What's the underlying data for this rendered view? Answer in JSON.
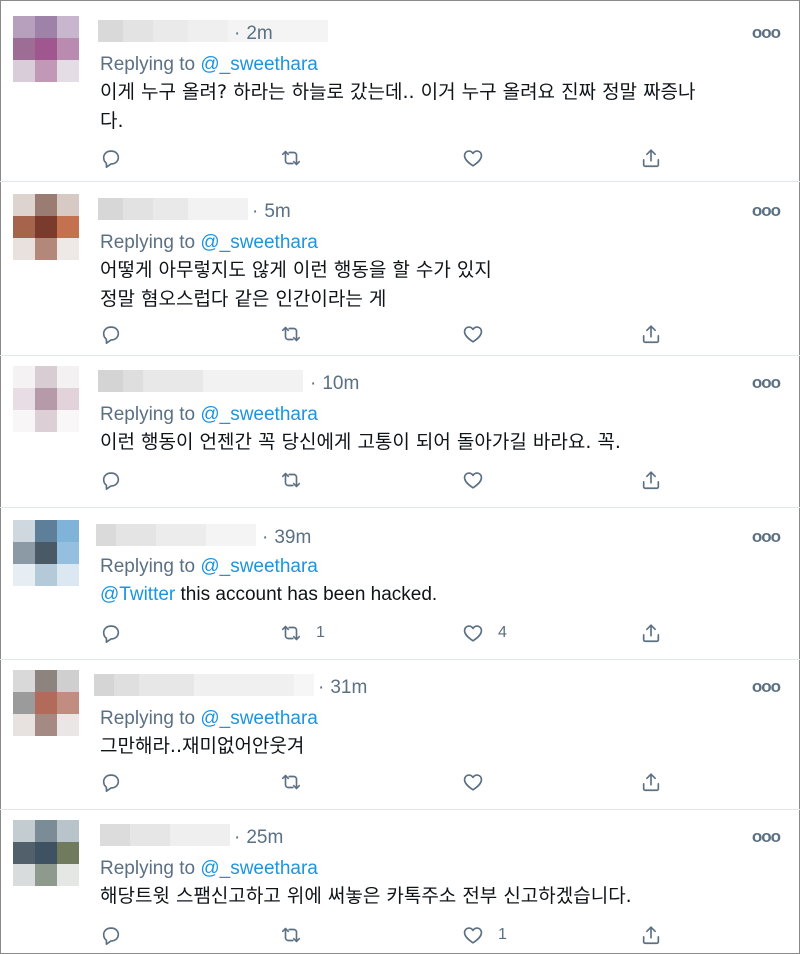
{
  "replying_label": "Replying to",
  "colors": {
    "muted": "#5b7083",
    "link": "#1b95e0",
    "text": "#0f1419",
    "divider": "#e1e6ea"
  },
  "icons": {
    "reply": "reply-icon",
    "retweet": "retweet-icon",
    "like": "like-icon",
    "share": "share-icon",
    "more": "more-icon"
  },
  "tweets": [
    {
      "time": "2m",
      "reply_to": "@_sweethara",
      "text": "이게 누구 올려? 하라는 하늘로 갔는데.. 이거 누구 올려요 진짜 정말 짜증나\n다.",
      "retweets": "",
      "likes": ""
    },
    {
      "time": "5m",
      "reply_to": "@_sweethara",
      "text": "어떻게 아무렇지도 않게 이런 행동을 할 수가 있지\n정말 혐오스럽다 같은 인간이라는 게",
      "retweets": "",
      "likes": ""
    },
    {
      "time": "10m",
      "reply_to": "@_sweethara",
      "text": "이런 행동이 언젠간 꼭 당신에게 고통이 되어 돌아가길 바라요. 꼭.",
      "retweets": "",
      "likes": ""
    },
    {
      "time": "39m",
      "reply_to": "@_sweethara",
      "mention": "@Twitter",
      "text": " this account has been hacked.",
      "retweets": "1",
      "likes": "4"
    },
    {
      "time": "31m",
      "reply_to": "@_sweethara",
      "text": "그만해라..재미없어안웃겨",
      "retweets": "",
      "likes": ""
    },
    {
      "time": "25m",
      "reply_to": "@_sweethara",
      "text": "해당트윗 스팸신고하고 위에 써놓은 카톡주소 전부 신고하겠습니다.",
      "retweets": "",
      "likes": "1"
    }
  ]
}
